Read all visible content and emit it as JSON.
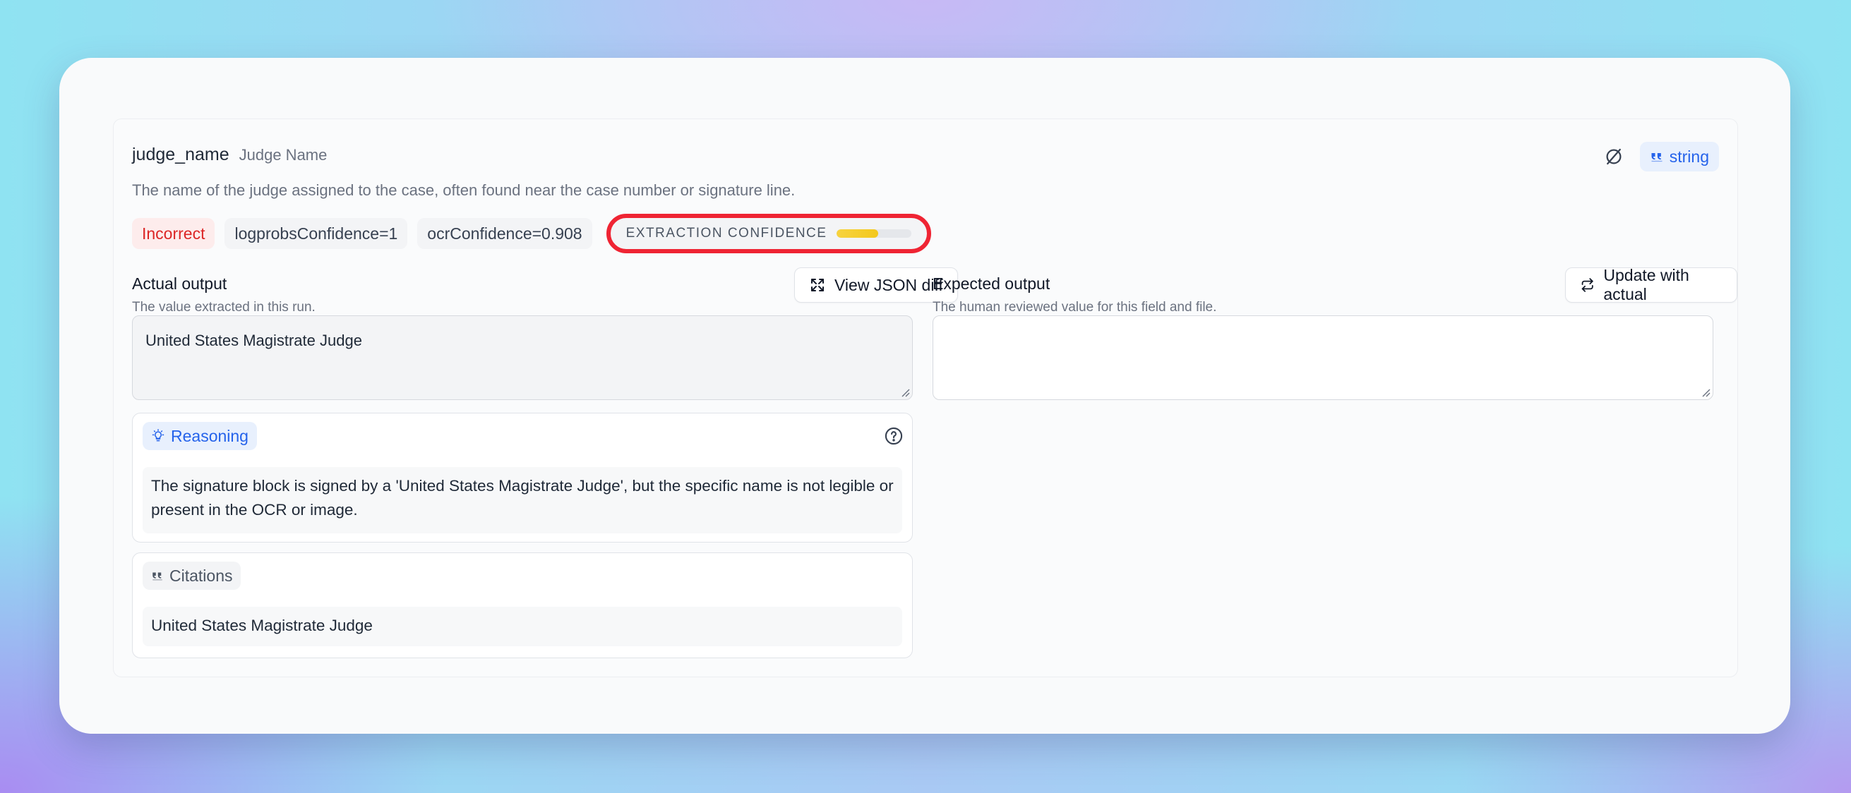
{
  "field": {
    "key": "judge_name",
    "label": "Judge Name",
    "description": "The name of the judge assigned to the case, often found near the case number or signature line.",
    "type": "string"
  },
  "status": {
    "verdict": "Incorrect",
    "logprobs": "logprobsConfidence=1",
    "ocr": "ocrConfidence=0.908",
    "extraction_label": "EXTRACTION CONFIDENCE",
    "extraction_value": 0.55
  },
  "actual": {
    "title": "Actual output",
    "subtitle": "The value extracted in this run.",
    "button": "View JSON diff",
    "value": "United States Magistrate Judge"
  },
  "expected": {
    "title": "Expected output",
    "subtitle": "The human reviewed value for this field and file.",
    "button": "Update with actual",
    "value": ""
  },
  "reasoning": {
    "label": "Reasoning",
    "text": "The signature block is signed by a 'United States Magistrate Judge', but the specific name is not legible or present in the OCR or image."
  },
  "citations": {
    "label": "Citations",
    "text": "United States Magistrate Judge"
  },
  "colors": {
    "accent_blue": "#2563eb",
    "incorrect_red": "#dc2626",
    "highlight_ring": "#ef2433",
    "confidence_fill": "#f3c81c"
  }
}
